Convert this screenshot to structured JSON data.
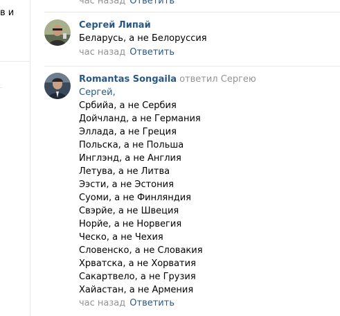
{
  "sidebar_fragments": {
    "line1": "в и"
  },
  "top_comment": {
    "time": "час назад",
    "reply_label": "Ответить"
  },
  "comment_1": {
    "author": "Сергей Липай",
    "text": "Беларусь, а не Белоруссия",
    "time": "час назад",
    "reply_label": "Ответить"
  },
  "comment_2": {
    "author": "Romantas Songaila",
    "replied_label": "ответил",
    "reply_to": "Сергею",
    "addressee": "Сергей,",
    "lines": [
      "Србийа, а не Сербия",
      "Дойчланд, а не Германия",
      "Эллада, а не Греция",
      "Польска, а не Польша",
      "Инглэнд, а не Англия",
      "Летува, а не Литва",
      "Ээсти, а не Эстония",
      "Суоми, а не Финляндия",
      "Свэрйе, а не Швеция",
      "Норйе, а не Норвегия",
      "Ческо, а не Чехия",
      "Словенско, а не Словакия",
      "Хрватска, а не Хорватия",
      "Сакартвело, а не Грузия",
      "Хайастан, а не Армения"
    ],
    "time": "час назад",
    "reply_label": "Ответить"
  },
  "colors": {
    "link": "#2a5885",
    "meta": "#939393",
    "separator": "#e7e8ec"
  }
}
